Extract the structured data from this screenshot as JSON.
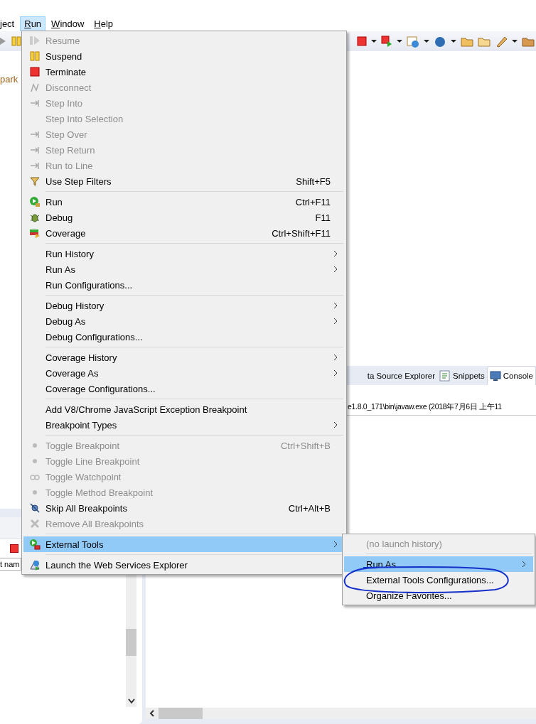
{
  "menu_bar": [
    {
      "label": "ject",
      "selected": false
    },
    {
      "label": "Run",
      "mnemonic": true,
      "selected": true
    },
    {
      "label": "Window",
      "mnemonic": true,
      "selected": false
    },
    {
      "label": "Help",
      "mnemonic": true,
      "selected": false
    }
  ],
  "left_pane": {
    "item": "park",
    "field_value": "t nam"
  },
  "bottom_tabs": [
    {
      "label": "ta Source Explorer",
      "selected": false
    },
    {
      "label": "Snippets",
      "selected": false
    },
    {
      "label": "Console",
      "selected": true
    }
  ],
  "console": {
    "line": "e1.8.0_171\\bin\\javaw.exe (2018年7月6日 上午11"
  },
  "run_menu": {
    "groups": [
      [
        {
          "label": "Resume",
          "disabled": true,
          "submenu": false,
          "selected": false
        },
        {
          "label": "Suspend",
          "disabled": false,
          "submenu": false,
          "selected": false
        },
        {
          "label": "Terminate",
          "disabled": false,
          "submenu": false,
          "selected": false
        },
        {
          "label": "Disconnect",
          "disabled": true,
          "submenu": false,
          "selected": false
        },
        {
          "label": "Step Into",
          "disabled": true,
          "submenu": false,
          "selected": false
        },
        {
          "label": "Step Into Selection",
          "disabled": true,
          "submenu": false,
          "selected": false
        },
        {
          "label": "Step Over",
          "disabled": true,
          "submenu": false,
          "selected": false
        },
        {
          "label": "Step Return",
          "disabled": true,
          "submenu": false,
          "selected": false
        },
        {
          "label": "Run to Line",
          "disabled": true,
          "submenu": false,
          "selected": false
        },
        {
          "label": "Use Step Filters",
          "shortcut": "Shift+F5",
          "disabled": false,
          "submenu": false,
          "selected": false
        }
      ],
      [
        {
          "label": "Run",
          "shortcut": "Ctrl+F11",
          "disabled": false,
          "submenu": false,
          "selected": false
        },
        {
          "label": "Debug",
          "shortcut": "F11",
          "disabled": false,
          "submenu": false,
          "selected": false
        },
        {
          "label": "Coverage",
          "shortcut": "Ctrl+Shift+F11",
          "disabled": false,
          "submenu": false,
          "selected": false
        }
      ],
      [
        {
          "label": "Run History",
          "disabled": false,
          "submenu": true,
          "selected": false
        },
        {
          "label": "Run As",
          "disabled": false,
          "submenu": true,
          "selected": false
        },
        {
          "label": "Run Configurations...",
          "disabled": false,
          "submenu": false,
          "selected": false
        }
      ],
      [
        {
          "label": "Debug History",
          "disabled": false,
          "submenu": true,
          "selected": false
        },
        {
          "label": "Debug As",
          "disabled": false,
          "submenu": true,
          "selected": false
        },
        {
          "label": "Debug Configurations...",
          "disabled": false,
          "submenu": false,
          "selected": false
        }
      ],
      [
        {
          "label": "Coverage History",
          "disabled": false,
          "submenu": true,
          "selected": false
        },
        {
          "label": "Coverage As",
          "disabled": false,
          "submenu": true,
          "selected": false
        },
        {
          "label": "Coverage Configurations...",
          "disabled": false,
          "submenu": false,
          "selected": false
        }
      ],
      [
        {
          "label": "Add V8/Chrome JavaScript Exception Breakpoint",
          "disabled": false,
          "submenu": false,
          "selected": false
        },
        {
          "label": "Breakpoint Types",
          "disabled": false,
          "submenu": true,
          "selected": false
        }
      ],
      [
        {
          "label": "Toggle Breakpoint",
          "shortcut": "Ctrl+Shift+B",
          "disabled": true,
          "submenu": false,
          "selected": false
        },
        {
          "label": "Toggle Line Breakpoint",
          "disabled": true,
          "submenu": false,
          "selected": false
        },
        {
          "label": "Toggle Watchpoint",
          "disabled": true,
          "submenu": false,
          "selected": false
        },
        {
          "label": "Toggle Method Breakpoint",
          "disabled": true,
          "submenu": false,
          "selected": false
        },
        {
          "label": "Skip All Breakpoints",
          "shortcut": "Ctrl+Alt+B",
          "disabled": false,
          "submenu": false,
          "selected": false
        },
        {
          "label": "Remove All Breakpoints",
          "disabled": true,
          "submenu": false,
          "selected": false
        }
      ],
      [
        {
          "label": "External Tools",
          "disabled": false,
          "submenu": true,
          "selected": true
        }
      ],
      [
        {
          "label": "Launch the Web Services Explorer",
          "disabled": false,
          "submenu": false,
          "selected": false
        }
      ]
    ]
  },
  "external_tools_menu": {
    "groups": [
      [
        {
          "label": "(no launch history)",
          "disabled": true,
          "submenu": false,
          "selected": false,
          "circled": false
        }
      ],
      [
        {
          "label": "Run As",
          "disabled": false,
          "submenu": true,
          "selected": true,
          "circled": false
        },
        {
          "label": "External Tools Configurations...",
          "disabled": false,
          "submenu": false,
          "selected": false,
          "circled": true
        },
        {
          "label": "Organize Favorites...",
          "disabled": false,
          "submenu": false,
          "selected": false,
          "circled": false
        }
      ]
    ]
  }
}
